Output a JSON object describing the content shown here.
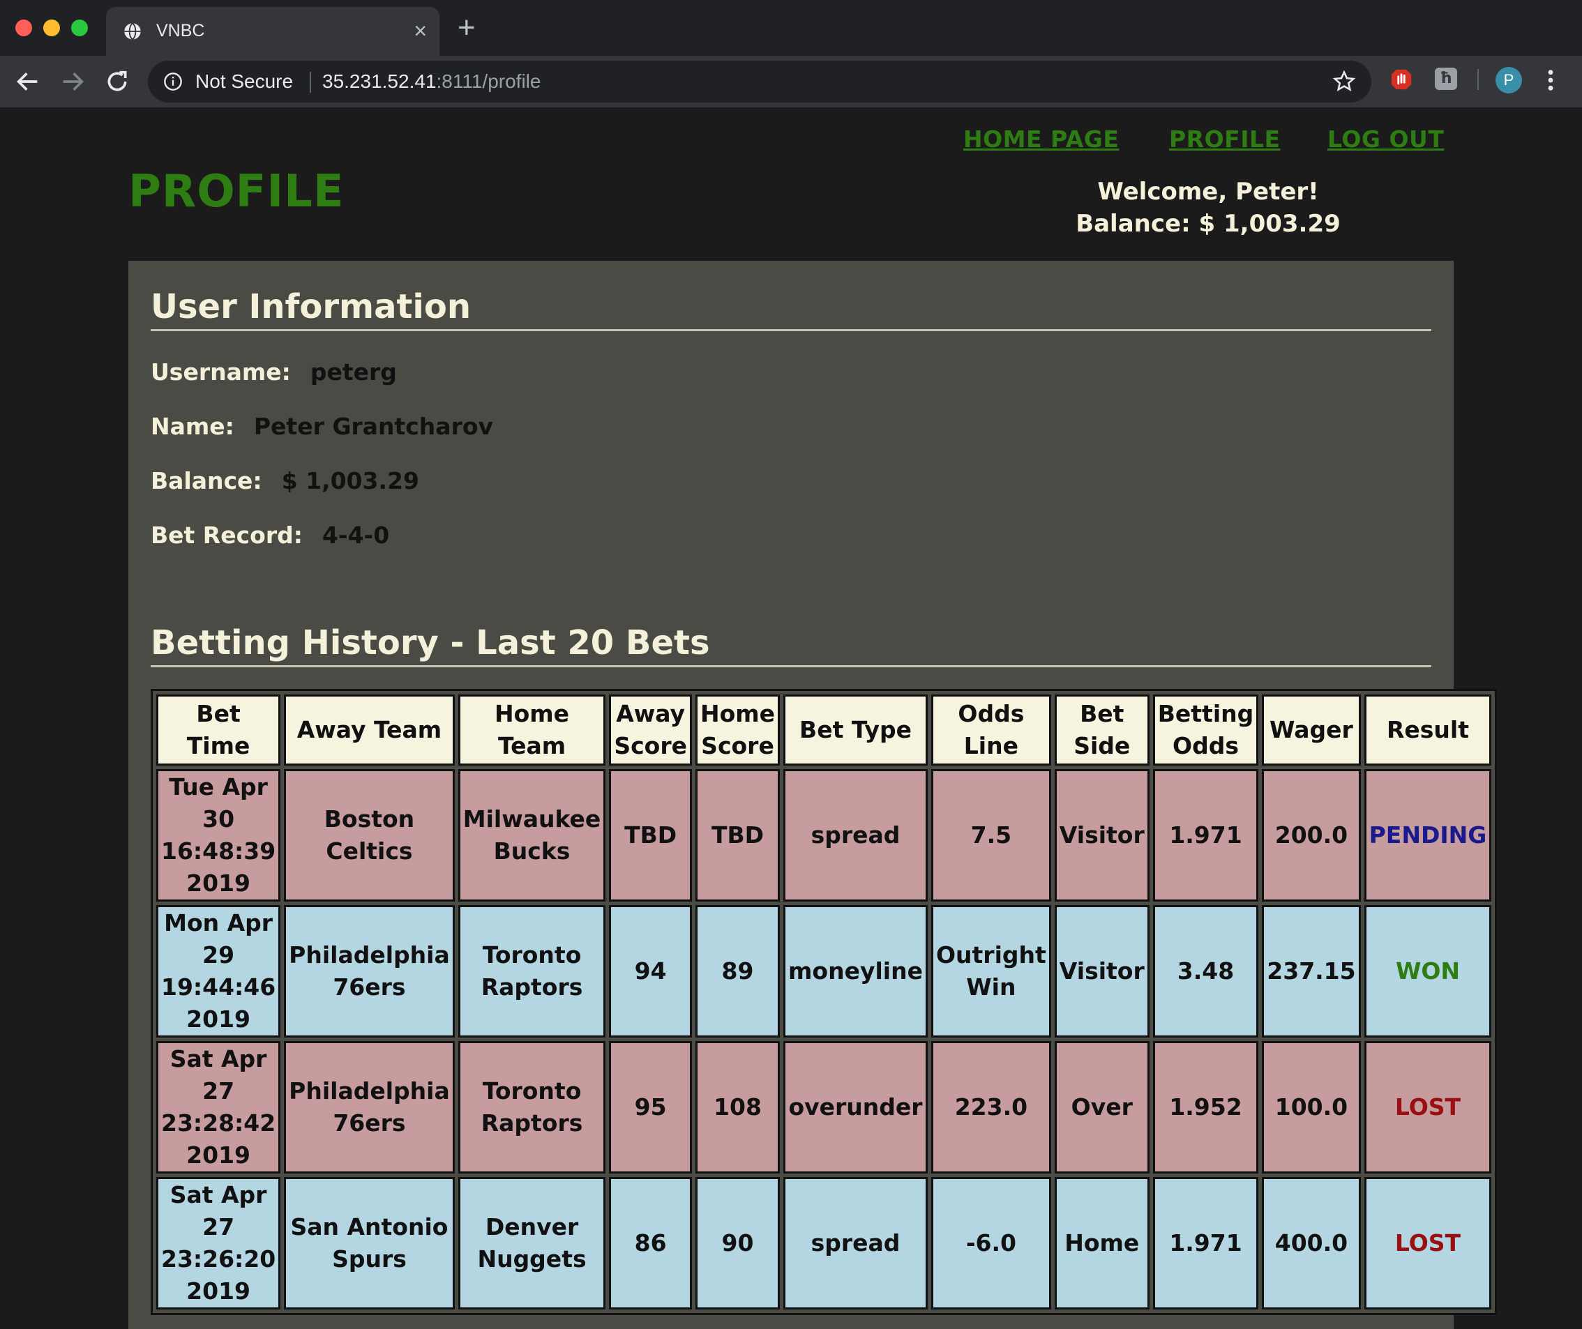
{
  "browser": {
    "tab_title": "VNBC",
    "tab_close": "×",
    "new_tab": "+",
    "security_label": "Not Secure",
    "url_host": "35.231.52.41",
    "url_path": ":8111/profile",
    "profile_initial": "P"
  },
  "nav": {
    "home": "HOME PAGE",
    "profile": "PROFILE",
    "logout": "LOG OUT"
  },
  "page_title": "PROFILE",
  "welcome": {
    "greeting": "Welcome, Peter!",
    "balance": "Balance: $ 1,003.29"
  },
  "user_info": {
    "heading": "User Information",
    "username_label": "Username:",
    "username": "peterg",
    "name_label": "Name:",
    "name": "Peter Grantcharov",
    "balance_label": "Balance:",
    "balance": "$ 1,003.29",
    "record_label": "Bet Record:",
    "record": "4-4-0"
  },
  "history": {
    "heading": "Betting History - Last 20 Bets",
    "columns": [
      "Bet Time",
      "Away Team",
      "Home Team",
      "Away Score",
      "Home Score",
      "Bet Type",
      "Odds Line",
      "Bet Side",
      "Betting Odds",
      "Wager",
      "Result"
    ],
    "rows": [
      {
        "bet_time": "Tue Apr 30 16:48:39 2019",
        "away_team": "Boston Celtics",
        "home_team": "Milwaukee Bucks",
        "away_score": "TBD",
        "home_score": "TBD",
        "bet_type": "spread",
        "odds_line": "7.5",
        "bet_side": "Visitor",
        "betting_odds": "1.971",
        "wager": "200.0",
        "result": "PENDING"
      },
      {
        "bet_time": "Mon Apr 29 19:44:46 2019",
        "away_team": "Philadelphia 76ers",
        "home_team": "Toronto Raptors",
        "away_score": "94",
        "home_score": "89",
        "bet_type": "moneyline",
        "odds_line": "Outright Win",
        "bet_side": "Visitor",
        "betting_odds": "3.48",
        "wager": "237.15",
        "result": "WON"
      },
      {
        "bet_time": "Sat Apr 27 23:28:42 2019",
        "away_team": "Philadelphia 76ers",
        "home_team": "Toronto Raptors",
        "away_score": "95",
        "home_score": "108",
        "bet_type": "overunder",
        "odds_line": "223.0",
        "bet_side": "Over",
        "betting_odds": "1.952",
        "wager": "100.0",
        "result": "LOST"
      },
      {
        "bet_time": "Sat Apr 27 23:26:20 2019",
        "away_team": "San Antonio Spurs",
        "home_team": "Denver Nuggets",
        "away_score": "86",
        "home_score": "90",
        "bet_type": "spread",
        "odds_line": "-6.0",
        "bet_side": "Home",
        "betting_odds": "1.971",
        "wager": "400.0",
        "result": "LOST"
      }
    ]
  },
  "colors": {
    "accent_green": "#2e7d12",
    "row_red": "#c79c9e",
    "row_blue": "#b4d6e2",
    "pending": "#1a1a8c",
    "lost": "#9a1010"
  }
}
